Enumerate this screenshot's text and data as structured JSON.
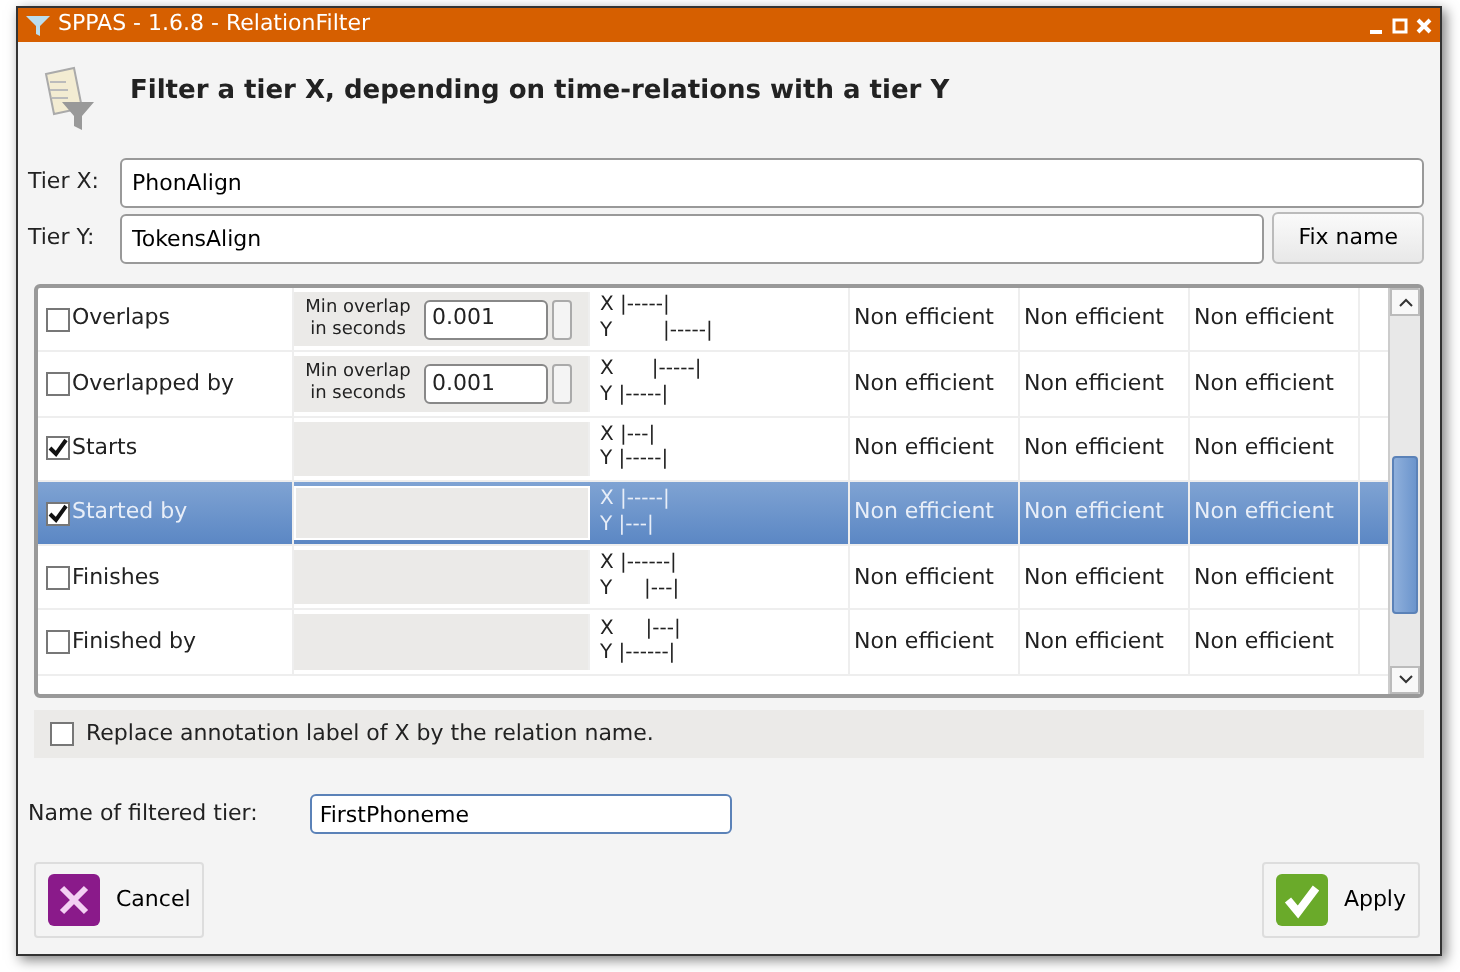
{
  "window": {
    "title": "SPPAS - 1.6.8 - RelationFilter"
  },
  "header": {
    "title": "Filter a tier X, depending on time-relations with a tier Y"
  },
  "tier_x": {
    "label": "Tier X:",
    "value": "PhonAlign"
  },
  "tier_y": {
    "label": "Tier Y:",
    "value": "TokensAlign",
    "button": "Fix name"
  },
  "relations": [
    {
      "name": "Overlaps",
      "checked": false,
      "selected": false,
      "option": {
        "label": "Min overlap in seconds",
        "value": "0.001"
      },
      "diagram": [
        "X |-----|",
        "Y        |-----|"
      ],
      "column_4": "Non efficient",
      "column_5": "Non efficient",
      "column_6": "Non efficient"
    },
    {
      "name": "Overlapped by",
      "checked": false,
      "selected": false,
      "option": {
        "label": "Min overlap in seconds",
        "value": "0.001"
      },
      "diagram": [
        "X      |-----|",
        "Y |-----|"
      ],
      "column_4": "Non efficient",
      "column_5": "Non efficient",
      "column_6": "Non efficient"
    },
    {
      "name": "Starts",
      "checked": true,
      "selected": false,
      "diagram": [
        "X |---|",
        "Y |-----|"
      ],
      "column_4": "Non efficient",
      "column_5": "Non efficient",
      "column_6": "Non efficient"
    },
    {
      "name": "Started by",
      "checked": true,
      "selected": true,
      "diagram": [
        "X |-----|",
        "Y |---|"
      ],
      "column_4": "Non efficient",
      "column_5": "Non efficient",
      "column_6": "Non efficient"
    },
    {
      "name": "Finishes",
      "checked": false,
      "selected": false,
      "diagram": [
        "X |------|",
        "Y     |---|"
      ],
      "column_4": "Non efficient",
      "column_5": "Non efficient",
      "column_6": "Non efficient"
    },
    {
      "name": "Finished by",
      "checked": false,
      "selected": false,
      "diagram": [
        "X     |---|",
        "Y |------|"
      ],
      "column_4": "Non efficient",
      "column_5": "Non efficient",
      "column_6": "Non efficient"
    }
  ],
  "replace_label": {
    "label": "Replace annotation label of X by the relation name.",
    "checked": false
  },
  "filtered_name": {
    "label": "Name of filtered tier:",
    "value": "FirstPhoneme"
  },
  "buttons": {
    "cancel": "Cancel",
    "apply": "Apply"
  }
}
